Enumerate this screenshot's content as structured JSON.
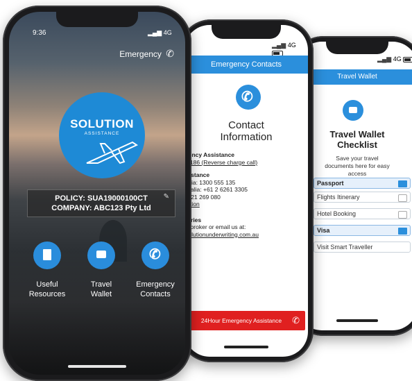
{
  "wallet_phone": {
    "status": {
      "signal": "4G"
    },
    "header": "Travel Wallet",
    "title": "Travel Wallet Checklist",
    "subtitle": "Save your travel documents here for easy access",
    "rows": [
      "Passport",
      "Flights Itinerary",
      "Hotel Booking",
      "Visa",
      "Visit Smart Traveller"
    ]
  },
  "contacts_phone": {
    "status": {
      "signal": "4G"
    },
    "header": "Emergency Contacts",
    "title": "Contact Information",
    "sections": [
      {
        "heading": "24Hr Emergency Assistance",
        "lines": [
          "+61 2 8912 5186 (Reverse charge call)"
        ]
      },
      {
        "heading": "Medical Assistance",
        "lines": [
          "Within Australia: 1300 555 135",
          "Outside Australia: +61 2 6261 3305",
          "Mobile: +61 421 269 080",
          "More information"
        ]
      },
      {
        "heading": "Policy Enquiries",
        "lines": [
          "Contact your broker or email us at:",
          "enquiries@solutionunderwriting.com.au"
        ]
      }
    ],
    "cta": "24Hour Emergency Assistance"
  },
  "home_phone": {
    "status": {
      "time": "9:36",
      "signal": "4G"
    },
    "emergency_link": "Emergency",
    "logo": {
      "brand": "SOLUTION",
      "sub": "ASSISTANCE"
    },
    "policy": "POLICY: SUA19000100CT",
    "company": "COMPANY: ABC123 Pty Ltd",
    "buttons": [
      {
        "label1": "Useful",
        "label2": "Resources",
        "icon": "document-icon"
      },
      {
        "label1": "Travel",
        "label2": "Wallet",
        "icon": "wallet-icon"
      },
      {
        "label1": "Emergency",
        "label2": "Contacts",
        "icon": "phone-plus-icon"
      }
    ]
  }
}
